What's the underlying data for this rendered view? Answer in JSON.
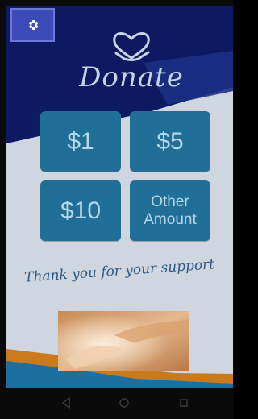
{
  "app": {
    "logo_text": "Donate",
    "thanks_text": "Thank you for your support"
  },
  "donation_options": [
    {
      "label": "$1"
    },
    {
      "label": "$5"
    },
    {
      "label": "$10"
    },
    {
      "label_line1": "Other",
      "label_line2": "Amount"
    }
  ],
  "icons": {
    "settings": "gear-icon",
    "logo": "heart-hands-icon",
    "nav_back": "back-triangle-icon",
    "nav_home": "home-circle-icon",
    "nav_recent": "recent-square-icon"
  },
  "colors": {
    "top_band": "#0d1a62",
    "button": "#1f6f98",
    "button_text": "#b9d7e6",
    "accent_orange": "#d9831f",
    "thanks_text": "#2d5a84"
  }
}
